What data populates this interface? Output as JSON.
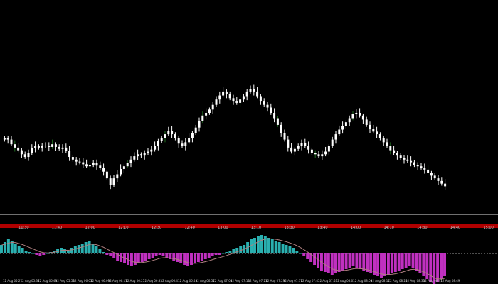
{
  "window": {
    "background": "#000000",
    "bull_color": "#ffffff",
    "bear_color": "#ffffff",
    "wick_color": "#ffffff",
    "green_shadow": "#1f6b1f",
    "separator_color": "#e0e0e0",
    "time_strip_color": "#b00000",
    "hist_positive_color": "#2ab0b0",
    "hist_negative_color": "#c030c0",
    "signal_line_color": "#b08080",
    "zero_line_color": "#9a9a9a"
  },
  "time_axis": {
    "labels": [
      "11:30",
      "11:40",
      "12:00",
      "12:10",
      "12:30",
      "12:40",
      "13:00",
      "13:10",
      "13:30",
      "13:40",
      "14:00",
      "14:10",
      "14:30",
      "14:40",
      "15:00"
    ]
  },
  "oscillator_axis": {
    "labels": [
      "12 Aug 05:27",
      "12 Aug 05:37",
      "12 Aug 05:49",
      "12 Aug 05:53",
      "12 Aug 06:05",
      "12 Aug 06:09",
      "12 Aug 06:17",
      "12 Aug 06:25",
      "12 Aug 06:33",
      "12 Aug 06:41",
      "12 Aug 06:49",
      "12 Aug 06:57",
      "12 Aug 07:05",
      "12 Aug 07:13",
      "12 Aug 07:21",
      "12 Aug 07:29",
      "12 Aug 07:37",
      "12 Aug 07:45",
      "12 Aug 07:53",
      "12 Aug 08:01",
      "12 Aug 08:09",
      "12 Aug 08:17",
      "12 Aug 08:25",
      "12 Aug 08:33",
      "12 Aug 08:41",
      "12 Aug 08:49"
    ]
  },
  "chart_data": [
    {
      "type": "candlestick",
      "description_source": "main price pane",
      "closes": [
        112,
        110,
        103,
        98,
        94,
        88,
        84,
        90,
        97,
        100,
        98,
        101,
        100,
        99,
        103,
        99,
        96,
        98,
        93,
        84,
        80,
        77,
        76,
        73,
        70,
        72,
        75,
        71,
        67,
        62,
        52,
        42,
        52,
        58,
        66,
        70,
        75,
        80,
        85,
        88,
        86,
        90,
        92,
        95,
        100,
        108,
        112,
        118,
        123,
        118,
        112,
        104,
        100,
        106,
        112,
        120,
        128,
        138,
        146,
        150,
        155,
        162,
        170,
        176,
        182,
        178,
        172,
        168,
        165,
        170,
        175,
        182,
        186,
        182,
        175,
        168,
        162,
        158,
        150,
        142,
        132,
        120,
        110,
        98,
        92,
        96,
        100,
        105,
        100,
        95,
        90,
        88,
        85,
        88,
        92,
        100,
        110,
        118,
        125,
        130,
        136,
        142,
        148,
        150,
        146,
        140,
        132,
        126,
        122,
        118,
        112,
        106,
        100,
        94,
        90,
        86,
        82,
        80,
        78,
        76,
        72,
        70,
        68,
        65,
        60,
        56,
        52,
        48,
        44,
        40
      ],
      "y_range": [
        0,
        300
      ]
    },
    {
      "type": "bar",
      "description_source": "oscillator histogram",
      "values": [
        6,
        8,
        10,
        9,
        7,
        5,
        4,
        2,
        1,
        0,
        -1,
        -2,
        -1,
        0,
        1,
        2,
        3,
        4,
        3,
        2,
        4,
        5,
        6,
        7,
        8,
        9,
        7,
        5,
        3,
        1,
        -1,
        -2,
        -3,
        -5,
        -6,
        -7,
        -8,
        -9,
        -8,
        -7,
        -6,
        -5,
        -4,
        -3,
        -2,
        -1,
        -2,
        -3,
        -4,
        -5,
        -6,
        -7,
        -8,
        -9,
        -8,
        -7,
        -6,
        -5,
        -4,
        -3,
        -2,
        -1,
        -1,
        0,
        1,
        2,
        3,
        4,
        5,
        6,
        8,
        10,
        11,
        12,
        13,
        12,
        11,
        10,
        9,
        8,
        7,
        6,
        5,
        4,
        2,
        0,
        -2,
        -4,
        -6,
        -8,
        -10,
        -12,
        -13,
        -14,
        -15,
        -14,
        -13,
        -12,
        -11,
        -10,
        -9,
        -10,
        -11,
        -12,
        -13,
        -14,
        -15,
        -16,
        -17,
        -16,
        -15,
        -14,
        -13,
        -12,
        -11,
        -10,
        -9,
        -10,
        -12,
        -14,
        -16,
        -18,
        -20,
        -22,
        -20,
        -18,
        -16
      ],
      "y_range": [
        -25,
        15
      ]
    }
  ]
}
